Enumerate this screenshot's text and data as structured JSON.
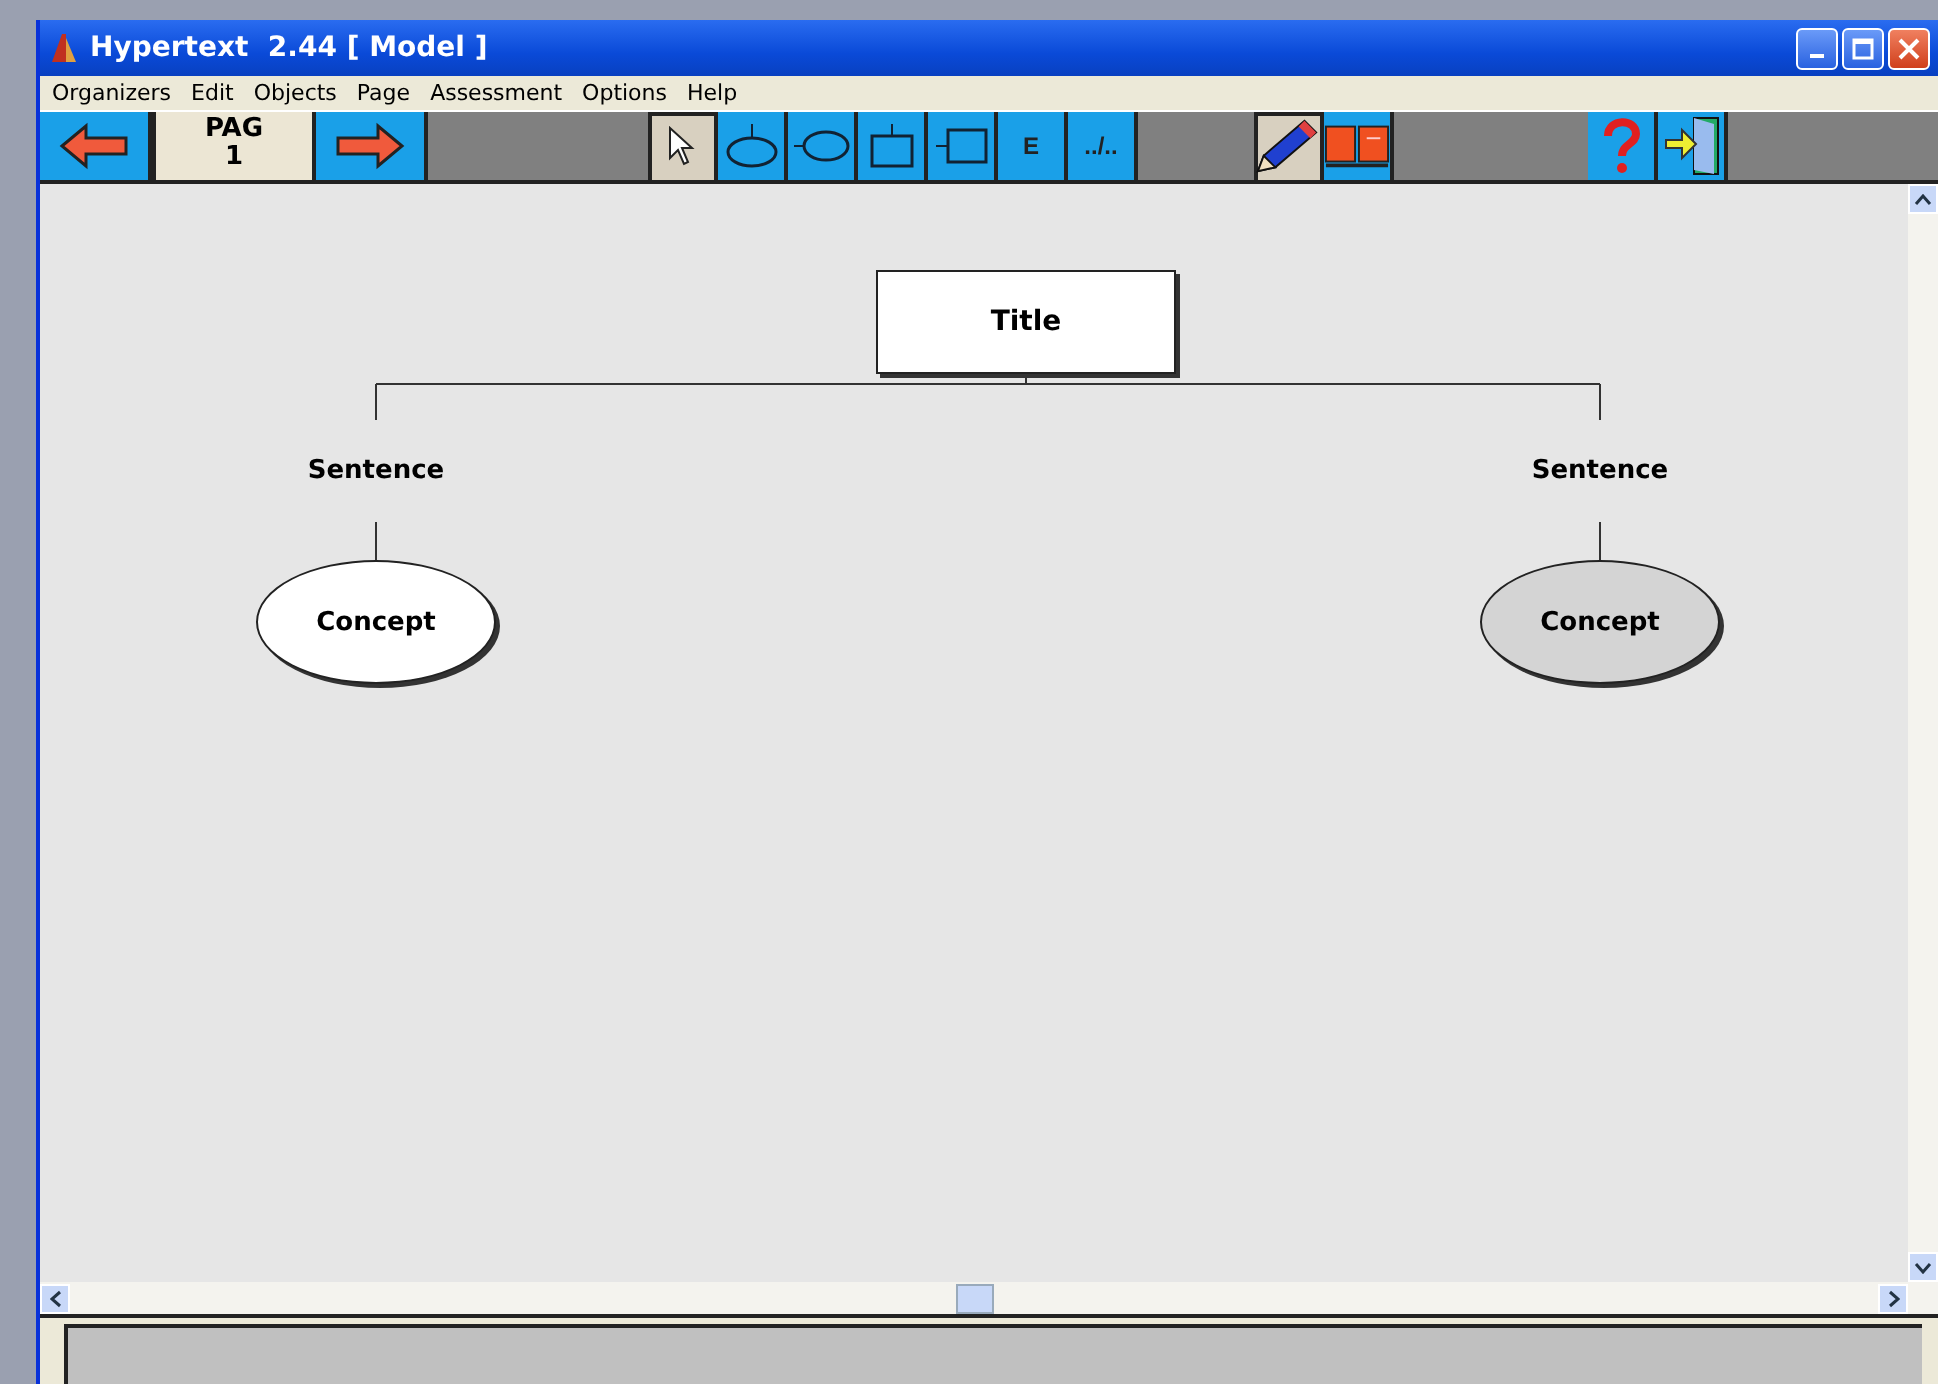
{
  "window": {
    "title": "Hypertext  2.44 [ Model ]"
  },
  "menu": [
    {
      "label": "Organizers"
    },
    {
      "label": "Edit"
    },
    {
      "label": "Objects"
    },
    {
      "label": "Page"
    },
    {
      "label": "Assessment"
    },
    {
      "label": "Options"
    },
    {
      "label": "Help"
    }
  ],
  "toolbar": [
    {
      "kind": "prev"
    },
    {
      "kind": "page",
      "label": "PAG",
      "number": "1"
    },
    {
      "kind": "next"
    },
    {
      "kind": "gap"
    },
    {
      "kind": "pointer",
      "selected": true
    },
    {
      "kind": "ellipse-top",
      "selected": false
    },
    {
      "kind": "ellipse-left",
      "selected": false
    },
    {
      "kind": "rect-top",
      "selected": false
    },
    {
      "kind": "rect-left",
      "selected": false
    },
    {
      "kind": "text",
      "label": "E",
      "selected": false
    },
    {
      "kind": "text",
      "label": "../..",
      "selected": false
    },
    {
      "kind": "gap"
    },
    {
      "kind": "pencil",
      "selected": true
    },
    {
      "kind": "book",
      "selected": false
    },
    {
      "kind": "gap"
    },
    {
      "kind": "help",
      "selected": false
    },
    {
      "kind": "exit",
      "selected": false
    },
    {
      "kind": "gap"
    }
  ],
  "diagram": {
    "title": "Title",
    "branches": [
      {
        "sentence": "Sentence",
        "concept": "Concept",
        "selected": false
      },
      {
        "sentence": "Sentence",
        "concept": "Concept",
        "selected": true
      }
    ]
  }
}
